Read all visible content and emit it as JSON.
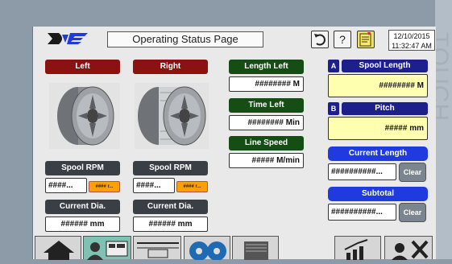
{
  "header": {
    "title": "Operating Status Page",
    "date": "12/10/2015",
    "time": "11:32:47 AM",
    "back_label": "↺",
    "help_label": "?"
  },
  "bezel_text": "TOUCH",
  "spools": {
    "left": {
      "label": "Left",
      "rpm_label": "Spool RPM",
      "rpm_value": "####...",
      "rpm_alt": "#### r...",
      "dia_label": "Current Dia.",
      "dia_value": "###### mm"
    },
    "right": {
      "label": "Right",
      "rpm_label": "Spool RPM",
      "rpm_value": "####...",
      "rpm_alt": "#### r...",
      "dia_label": "Current Dia.",
      "dia_value": "###### mm"
    }
  },
  "status": {
    "length_left_label": "Length Left",
    "length_left_value": "######## M",
    "time_left_label": "Time Left",
    "time_left_value": "######## Min",
    "line_speed_label": "Line Speed",
    "line_speed_value": "##### M/min"
  },
  "settings": {
    "a_tag": "A",
    "spool_length_label": "Spool Length",
    "spool_length_value": "######## M",
    "b_tag": "B",
    "pitch_label": "Pitch",
    "pitch_value": "##### mm"
  },
  "counters": {
    "current_length_label": "Current Length",
    "current_length_value": "##########...",
    "clear1": "Clear",
    "subtotal_label": "Subtotal",
    "subtotal_value": "##########...",
    "clear2": "Clear"
  },
  "colors": {
    "red": "#8c1111",
    "green": "#144e14",
    "navy": "#1d1f8c",
    "blue": "#1f3be0",
    "yellow": "#ffffb0",
    "orange": "#ffa000"
  }
}
